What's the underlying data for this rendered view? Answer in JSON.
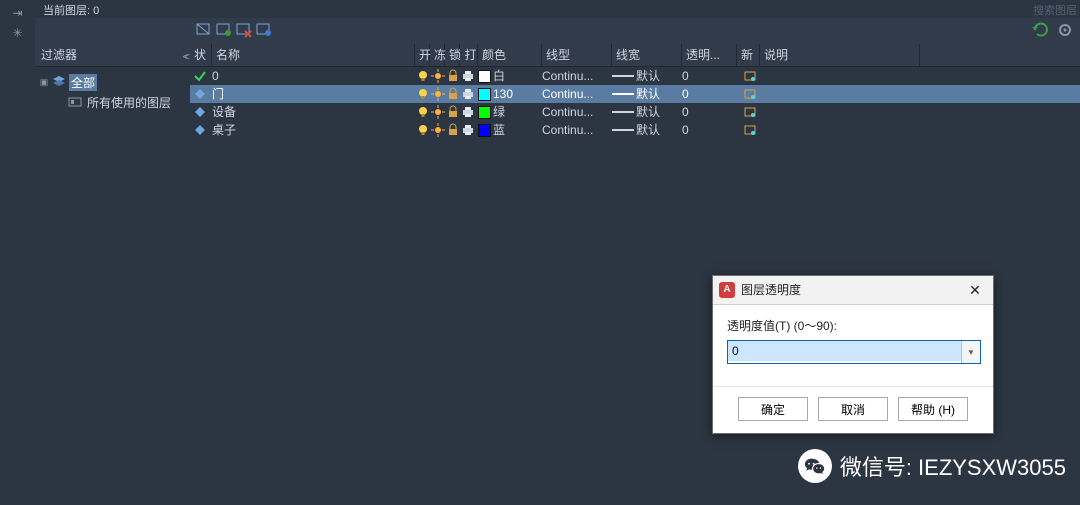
{
  "header": {
    "current_layer_label": "当前图层: 0",
    "search_placeholder": "搜索图层"
  },
  "toolbar": {
    "icons": [
      "layer-states-icon",
      "new-layer-icon",
      "delete-layer-icon",
      "freeze-layer-icon"
    ],
    "refresh": "refresh-icon",
    "settings": "settings-icon"
  },
  "filters": {
    "title": "过滤器",
    "tree": {
      "root": {
        "label": "全部",
        "selected": true
      },
      "child": {
        "label": "所有使用的图层"
      }
    }
  },
  "columns": {
    "status": "状",
    "name": "名称",
    "on": "开",
    "freeze": "冻",
    "lock": "锁",
    "plot": "打",
    "color": "颜色",
    "linetype": "线型",
    "lineweight": "线宽",
    "transparency": "透明...",
    "new": "新",
    "description": "说明"
  },
  "layers": [
    {
      "status": "current",
      "name": "0",
      "color_name": "白",
      "color_hex": "#ffffff",
      "linetype": "Continu...",
      "lineweight": "默认",
      "transparency": "0",
      "selected": false
    },
    {
      "status": "normal",
      "name": "门",
      "color_name": "130",
      "color_hex": "#00ffff",
      "linetype": "Continu...",
      "lineweight": "默认",
      "transparency": "0",
      "selected": true
    },
    {
      "status": "normal",
      "name": "设备",
      "color_name": "绿",
      "color_hex": "#00ff00",
      "linetype": "Continu...",
      "lineweight": "默认",
      "transparency": "0",
      "selected": false
    },
    {
      "status": "normal",
      "name": "桌子",
      "color_name": "蓝",
      "color_hex": "#0000ff",
      "linetype": "Continu...",
      "lineweight": "默认",
      "transparency": "0",
      "selected": false
    }
  ],
  "dialog": {
    "title": "图层透明度",
    "label": "透明度值(T) (0～90):",
    "value": "0",
    "ok": "确定",
    "cancel": "取消",
    "help": "帮助 (H)"
  },
  "watermark": {
    "text": "微信号: IEZYSXW3055"
  }
}
